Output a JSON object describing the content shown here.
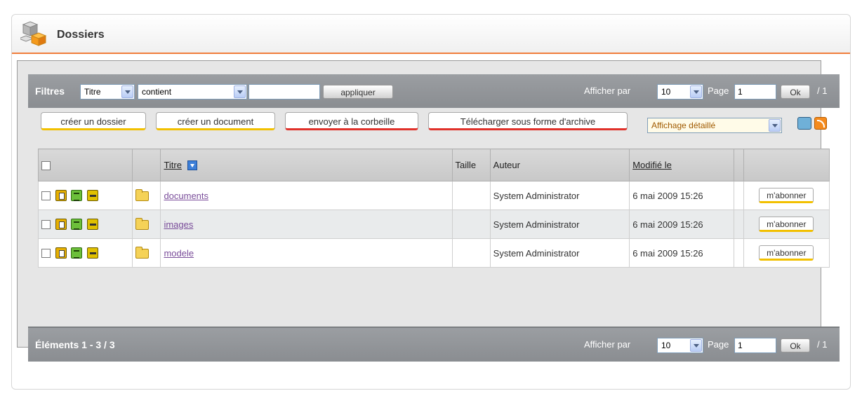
{
  "panel": {
    "title": "Dossiers",
    "logo_icon": "cubes-icon"
  },
  "filters": {
    "label": "Filtres",
    "field": "Titre",
    "operator": "contient",
    "value": "",
    "apply_label": "appliquer",
    "per_page_label": "Afficher par",
    "per_page": "10",
    "page_label": "Page",
    "page": "1",
    "ok_label": "Ok",
    "total_pages": "/ 1"
  },
  "actions": {
    "create_folder": "créer un dossier",
    "create_document": "créer un document",
    "send_trash": "envoyer à la corbeille",
    "download_archive": "Télécharger sous forme d'archive",
    "view_mode": "Affichage détaillé"
  },
  "table": {
    "headers": {
      "title": "Titre",
      "size": "Taille",
      "author": "Auteur",
      "modified": "Modifié le"
    },
    "rows": [
      {
        "title": "documents",
        "size": "",
        "author": "System Administrator",
        "modified": "6 mai 2009 15:26",
        "subscribe": "m'abonner"
      },
      {
        "title": "images",
        "size": "",
        "author": "System Administrator",
        "modified": "6 mai 2009 15:26",
        "subscribe": "m'abonner"
      },
      {
        "title": "modele",
        "size": "",
        "author": "System Administrator",
        "modified": "6 mai 2009 15:26",
        "subscribe": "m'abonner"
      }
    ]
  },
  "footer": {
    "items_label": "Éléments 1 - 3 / 3",
    "per_page_label": "Afficher par",
    "per_page": "10",
    "page_label": "Page",
    "page": "1",
    "ok_label": "Ok",
    "total_pages": "/ 1"
  },
  "colors": {
    "accent": "#f07d3a",
    "bar": "#8a8d91",
    "link": "#7a4d9a",
    "yellow_underline": "#f2c000",
    "red_underline": "#e0312a"
  }
}
